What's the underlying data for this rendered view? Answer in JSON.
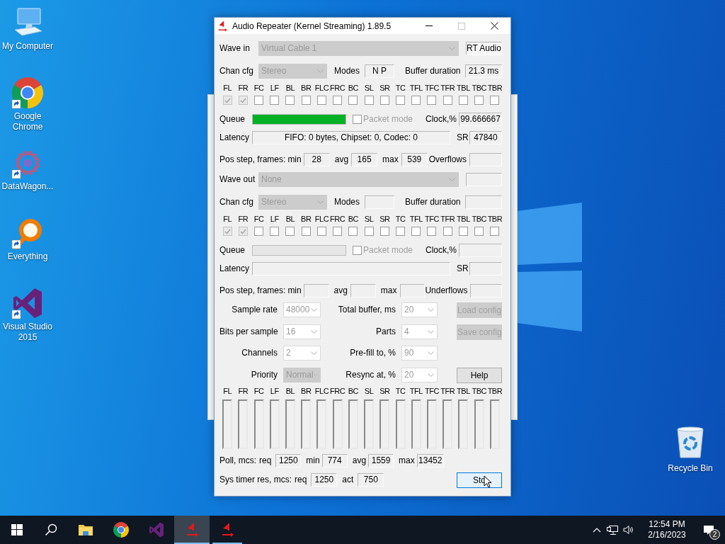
{
  "desktop": {
    "icons": [
      {
        "kind": "computer",
        "label": "My Computer",
        "shortcut": false
      },
      {
        "kind": "chrome",
        "label": "Google Chrome",
        "shortcut": true
      },
      {
        "kind": "datawagon",
        "label": "DataWagon...",
        "shortcut": true
      },
      {
        "kind": "everything",
        "label": "Everything",
        "shortcut": true
      },
      {
        "kind": "visualstudio",
        "label": "Visual Studio 2015",
        "shortcut": true
      }
    ],
    "recycle_bin": {
      "label": "Recycle Bin"
    }
  },
  "window": {
    "title": "Audio Repeater (Kernel Streaming) 1.89.5",
    "sections": [
      {
        "device_label": "Wave in",
        "device": {
          "value": "Virtual Cable 1",
          "editable": false
        },
        "badge": "RT Audio",
        "chan_cfg_label": "Chan cfg",
        "chan_cfg": {
          "value": "Stereo",
          "editable": false
        },
        "modes_label": "Modes",
        "modes": "N P",
        "buffer_label": "Buffer duration",
        "buffer": "21.3 ms",
        "channels": [
          {
            "label": "FL",
            "checked": true
          },
          {
            "label": "FR",
            "checked": true
          },
          {
            "label": "FC",
            "checked": false
          },
          {
            "label": "LF",
            "checked": false
          },
          {
            "label": "BL",
            "checked": false
          },
          {
            "label": "BR",
            "checked": false
          },
          {
            "label": "FLC",
            "checked": false
          },
          {
            "label": "FRC",
            "checked": false
          },
          {
            "label": "BC",
            "checked": false
          },
          {
            "label": "SL",
            "checked": false
          },
          {
            "label": "SR",
            "checked": false
          },
          {
            "label": "TC",
            "checked": false
          },
          {
            "label": "TFL",
            "checked": false
          },
          {
            "label": "TFC",
            "checked": false
          },
          {
            "label": "TFR",
            "checked": false
          },
          {
            "label": "TBL",
            "checked": false
          },
          {
            "label": "TBC",
            "checked": false
          },
          {
            "label": "TBR",
            "checked": false
          }
        ],
        "queue_label": "Queue",
        "queue": {
          "level": 1
        },
        "packet_mode": {
          "label": "Packet mode",
          "checked": false
        },
        "clock_label": "Clock,%",
        "clock": "99.666667",
        "latency_label": "Latency",
        "latency": "FIFO: 0 bytes, Chipset: 0, Codec: 0",
        "sr_label": "SR",
        "sr": "47840",
        "pos_label": "Pos step, frames:",
        "pos": [
          {
            "label": "min",
            "value": "28"
          },
          {
            "label": "avg",
            "value": "165"
          },
          {
            "label": "max",
            "value": "539"
          }
        ],
        "flow_label": "Overflows"
      },
      {
        "device_label": "Wave out",
        "device": {
          "value": "None",
          "editable": false
        },
        "chan_cfg_label": "Chan cfg",
        "chan_cfg": {
          "value": "Stereo",
          "editable": false
        },
        "modes_label": "Modes",
        "buffer_label": "Buffer duration",
        "channels": [
          {
            "label": "FL",
            "checked": true
          },
          {
            "label": "FR",
            "checked": true
          },
          {
            "label": "FC",
            "checked": false
          },
          {
            "label": "LF",
            "checked": false
          },
          {
            "label": "BL",
            "checked": false
          },
          {
            "label": "BR",
            "checked": false
          },
          {
            "label": "FLC",
            "checked": false
          },
          {
            "label": "FRC",
            "checked": false
          },
          {
            "label": "BC",
            "checked": false
          },
          {
            "label": "SL",
            "checked": false
          },
          {
            "label": "SR",
            "checked": false
          },
          {
            "label": "TC",
            "checked": false
          },
          {
            "label": "TFL",
            "checked": false
          },
          {
            "label": "TFC",
            "checked": false
          },
          {
            "label": "TFR",
            "checked": false
          },
          {
            "label": "TBL",
            "checked": false
          },
          {
            "label": "TBC",
            "checked": false
          },
          {
            "label": "TBR",
            "checked": false
          }
        ],
        "queue_label": "Queue",
        "queue": {
          "level": 0
        },
        "packet_mode": {
          "label": "Packet mode",
          "checked": false
        },
        "clock_label": "Clock,%",
        "latency_label": "Latency",
        "sr_label": "SR",
        "pos_label": "Pos step, frames:",
        "pos": [
          {
            "label": "min"
          },
          {
            "label": "avg"
          },
          {
            "label": "max"
          }
        ],
        "flow_label": "Underflows"
      }
    ],
    "settings": [
      {
        "left": {
          "label": "Sample rate",
          "value": "48000",
          "editable": true
        },
        "right": {
          "label": "Total buffer, ms",
          "value": "20",
          "editable": true
        },
        "button": {
          "label": "Load config",
          "disabled": true,
          "focused": false
        }
      },
      {
        "left": {
          "label": "Bits per sample",
          "value": "16",
          "editable": true
        },
        "right": {
          "label": "Parts",
          "value": "4",
          "editable": true
        },
        "button": {
          "label": "Save config",
          "disabled": true,
          "focused": false
        }
      },
      {
        "left": {
          "label": "Channels",
          "value": "2",
          "editable": true
        },
        "right": {
          "label": "Pre-fill to, %",
          "value": "90",
          "editable": true
        }
      },
      {
        "left": {
          "label": "Priority",
          "value": "Normal",
          "editable": false
        },
        "right": {
          "label": "Resync at, %",
          "value": "20",
          "editable": true
        },
        "button": {
          "label": "Help",
          "disabled": false,
          "focused": false
        }
      }
    ],
    "meters": [
      {
        "label": "FL",
        "level": 0
      },
      {
        "label": "FR",
        "level": 0
      },
      {
        "label": "FC",
        "level": 0
      },
      {
        "label": "LF",
        "level": 0
      },
      {
        "label": "BL",
        "level": 0
      },
      {
        "label": "BR",
        "level": 0
      },
      {
        "label": "FLC",
        "level": 0
      },
      {
        "label": "FRC",
        "level": 0
      },
      {
        "label": "BC",
        "level": 0
      },
      {
        "label": "SL",
        "level": 0
      },
      {
        "label": "SR",
        "level": 0
      },
      {
        "label": "TC",
        "level": 0
      },
      {
        "label": "TFL",
        "level": 0
      },
      {
        "label": "TFC",
        "level": 0
      },
      {
        "label": "TFR",
        "level": 0
      },
      {
        "label": "TBL",
        "level": 0
      },
      {
        "label": "TBC",
        "level": 0
      },
      {
        "label": "TBR",
        "level": 0
      }
    ],
    "poll": {
      "label": "Poll, mcs:",
      "fields": [
        {
          "label": "req",
          "value": "1250"
        },
        {
          "label": "min",
          "value": "774"
        },
        {
          "label": "avg",
          "value": "1559"
        },
        {
          "label": "max",
          "value": "13452"
        }
      ]
    },
    "timer": {
      "label": "Sys timer res, mcs:",
      "fields": [
        {
          "label": "req",
          "value": "1250"
        },
        {
          "label": "act",
          "value": "750"
        }
      ]
    },
    "stop_button": {
      "label": "Sto",
      "disabled": false,
      "focused": true
    }
  },
  "taskbar": {
    "apps": [
      {
        "kind": "folder",
        "open": false,
        "selected": false
      },
      {
        "kind": "chrome",
        "open": false,
        "selected": false
      },
      {
        "kind": "visualstudio",
        "open": false,
        "selected": false
      },
      {
        "kind": "repeater",
        "open": true,
        "selected": true
      },
      {
        "kind": "repeater",
        "open": true,
        "selected": false
      }
    ],
    "time": "12:54 PM",
    "date": "2/16/2023",
    "notification_count": "2"
  }
}
